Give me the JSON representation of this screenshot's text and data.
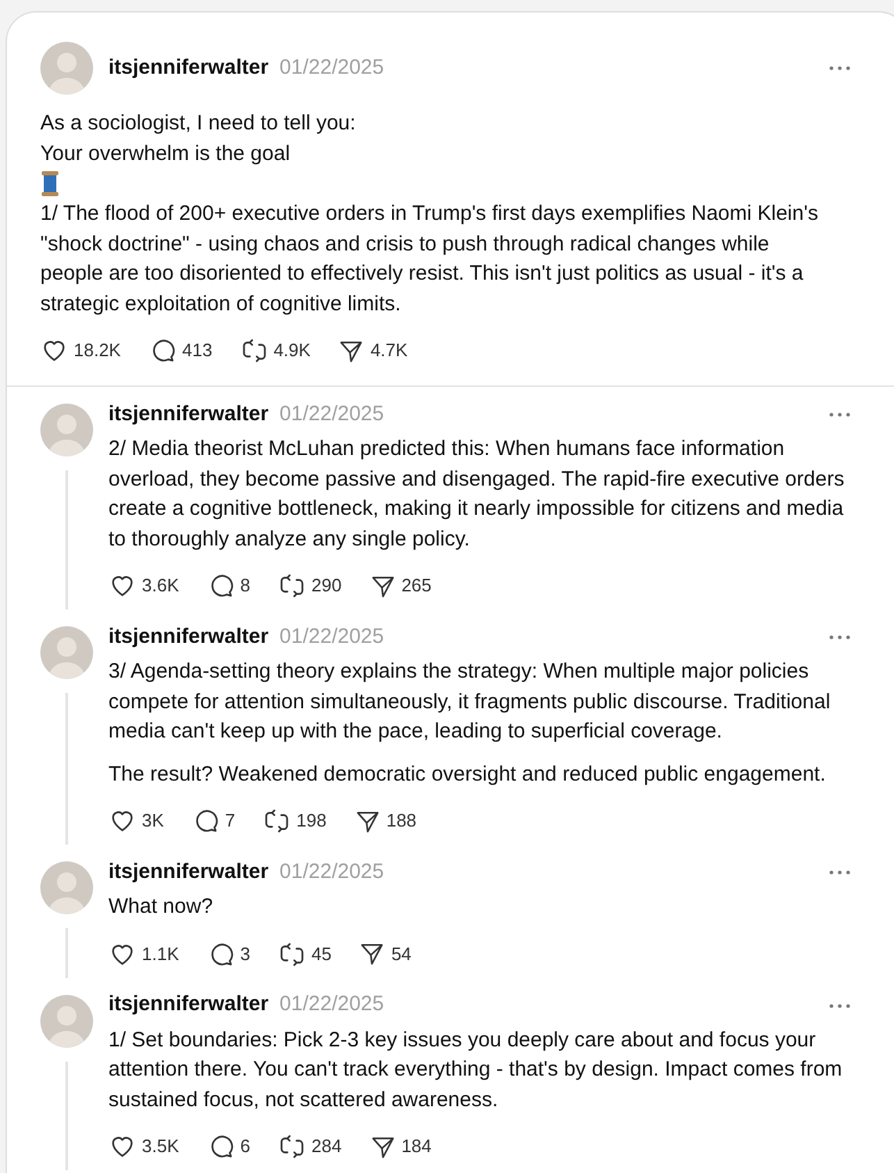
{
  "main_post": {
    "username": "itsjenniferwalter",
    "date": "01/22/2025",
    "intro_lines": [
      "As a sociologist, I need to tell you:",
      "Your overwhelm is the goal"
    ],
    "paragraphs": [
      "1/ The flood of 200+ executive orders in Trump's first days exemplifies Naomi Klein's \"shock doctrine\" - using chaos and crisis to push through radical changes while people are too disoriented to effectively resist. This isn't just politics as usual - it's a strategic exploitation of cognitive limits."
    ],
    "stats": {
      "likes": "18.2K",
      "replies": "413",
      "reposts": "4.9K",
      "shares": "4.7K"
    }
  },
  "replies": [
    {
      "username": "itsjenniferwalter",
      "date": "01/22/2025",
      "paragraphs": [
        "2/ Media theorist McLuhan predicted this: When humans face information overload, they become passive and disengaged. The rapid-fire executive orders create a cognitive bottleneck, making it nearly impossible for citizens and media to thoroughly analyze any single policy."
      ],
      "stats": {
        "likes": "3.6K",
        "replies": "8",
        "reposts": "290",
        "shares": "265"
      }
    },
    {
      "username": "itsjenniferwalter",
      "date": "01/22/2025",
      "paragraphs": [
        "3/ Agenda-setting theory explains the strategy: When multiple major policies compete for attention simultaneously, it fragments public discourse. Traditional media can't keep up with the pace, leading to superficial coverage.",
        "The result? Weakened democratic oversight and reduced public engagement."
      ],
      "stats": {
        "likes": "3K",
        "replies": "7",
        "reposts": "198",
        "shares": "188"
      }
    },
    {
      "username": "itsjenniferwalter",
      "date": "01/22/2025",
      "paragraphs": [
        "What now?"
      ],
      "stats": {
        "likes": "1.1K",
        "replies": "3",
        "reposts": "45",
        "shares": "54"
      }
    },
    {
      "username": "itsjenniferwalter",
      "date": "01/22/2025",
      "paragraphs": [
        "1/ Set boundaries: Pick 2-3 key issues you deeply care about and focus your attention there. You can't track everything - that's by design. Impact comes from sustained focus, not scattered awareness."
      ],
      "stats": {
        "likes": "3.5K",
        "replies": "6",
        "reposts": "284",
        "shares": "184"
      }
    }
  ]
}
